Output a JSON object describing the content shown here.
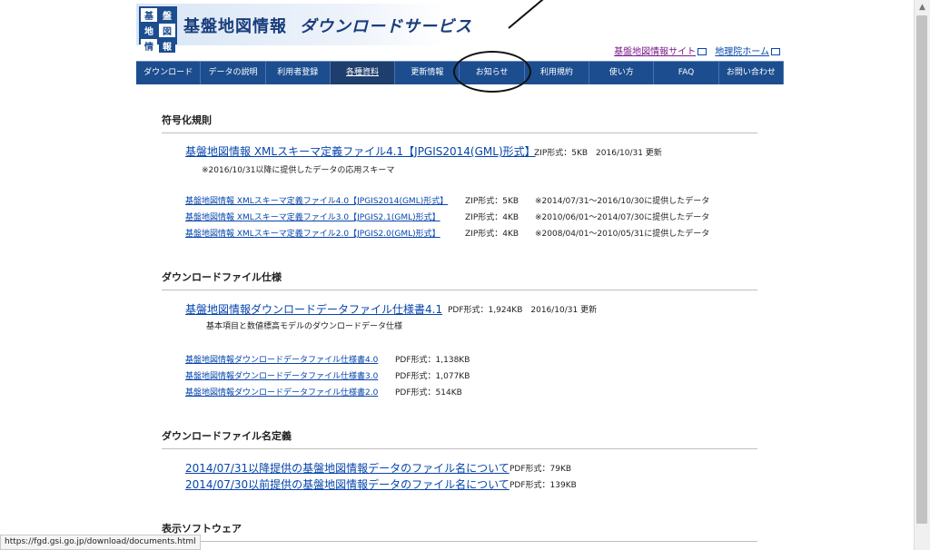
{
  "banner": {
    "logo_chars": [
      "基",
      "盤",
      "地",
      "図",
      "情",
      "報"
    ],
    "title": "基盤地図情報",
    "service": "ダウンロードサービス"
  },
  "toplinks": {
    "kiban_site": "基盤地図情報サイト",
    "gsi_home": "地理院ホーム"
  },
  "nav": [
    "ダウンロード",
    "データの説明",
    "利用者登録",
    "各種資料",
    "更新情報",
    "お知らせ",
    "利用規約",
    "使い方",
    "FAQ",
    "お問い合わせ"
  ],
  "sections": {
    "encoding": {
      "title": "符号化規則",
      "main_link": "基盤地図情報 XMLスキーマ定義ファイル4.1【JPGIS2014(GML)形式】",
      "main_meta": "ZIP形式：5KB　2016/10/31 更新",
      "main_note": "※2016/10/31以降に提供したデータの応用スキーマ",
      "old": [
        {
          "link": "基盤地図情報 XMLスキーマ定義ファイル4.0【JPGIS2014(GML)形式】",
          "size": "ZIP形式：5KB",
          "note": "※2014/07/31～2016/10/30に提供したデータ"
        },
        {
          "link": "基盤地図情報 XMLスキーマ定義ファイル3.0【JPGIS2.1(GML)形式】",
          "size": "ZIP形式：4KB",
          "note": "※2010/06/01～2014/07/30に提供したデータ"
        },
        {
          "link": "基盤地図情報 XMLスキーマ定義ファイル2.0【JPGIS2.0(GML)形式】",
          "size": "ZIP形式：4KB",
          "note": "※2008/04/01～2010/05/31に提供したデータ"
        }
      ]
    },
    "spec": {
      "title": "ダウンロードファイル仕様",
      "main_link": "基盤地図情報ダウンロードデータファイル仕様書4.1",
      "main_meta": "PDF形式：1,924KB　2016/10/31 更新",
      "main_note": "基本項目と数値標高モデルのダウンロードデータ仕様",
      "old": [
        {
          "link": "基盤地図情報ダウンロードデータファイル仕様書4.0",
          "size": "PDF形式：1,138KB"
        },
        {
          "link": "基盤地図情報ダウンロードデータファイル仕様書3.0",
          "size": "PDF形式：1,077KB"
        },
        {
          "link": "基盤地図情報ダウンロードデータファイル仕様書2.0",
          "size": "PDF形式：514KB"
        }
      ]
    },
    "naming": {
      "title": "ダウンロードファイル名定義",
      "items": [
        {
          "link": "2014/07/31以降提供の基盤地図情報データのファイル名について",
          "size": "PDF形式：79KB"
        },
        {
          "link": "2014/07/30以前提供の基盤地図情報データのファイル名について",
          "size": "PDF形式：139KB"
        }
      ]
    },
    "software": {
      "title": "表示ソフトウェア"
    }
  },
  "status_url": "https://fgd.gsi.go.jp/download/documents.html"
}
